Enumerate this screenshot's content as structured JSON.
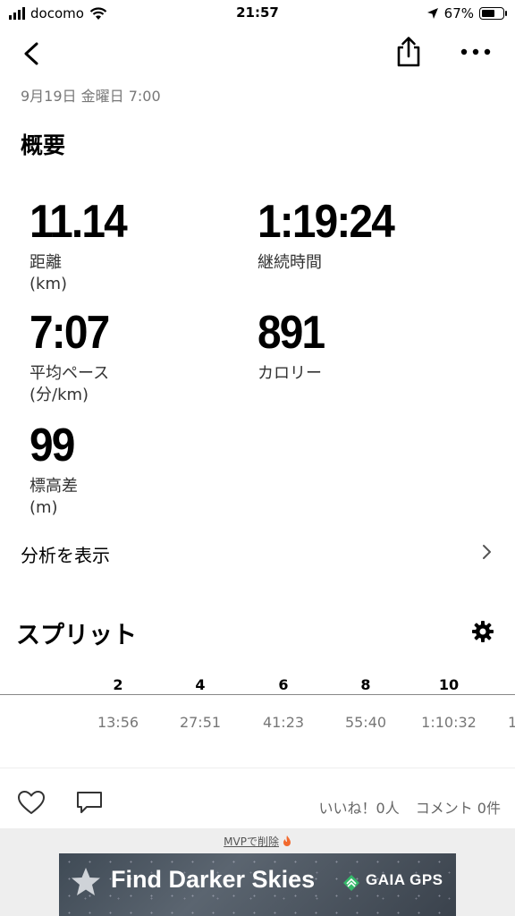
{
  "status_bar": {
    "carrier": "docomo",
    "time": "21:57",
    "battery": "67%"
  },
  "activity": {
    "date": "9月19日 金曜日 7:00",
    "summary_title": "概要",
    "metrics": [
      {
        "value": "11.14",
        "label": "距離",
        "unit": "(km)"
      },
      {
        "value": "1:19:24",
        "label": "継続時間",
        "unit": ""
      },
      {
        "value": "7:07",
        "label": "平均ペース",
        "unit": "(分/km)"
      },
      {
        "value": "891",
        "label": "カロリー",
        "unit": ""
      },
      {
        "value": "99",
        "label": "標高差",
        "unit": "(m)"
      }
    ],
    "analysis_link": "分析を表示"
  },
  "splits": {
    "title": "スプリット",
    "headers": [
      "2",
      "4",
      "6",
      "8",
      "10"
    ],
    "values": [
      "13:56",
      "27:51",
      "41:23",
      "55:40",
      "1:10:32",
      "1"
    ]
  },
  "social": {
    "likes": "いいね！0人",
    "comments": "コメント 0件"
  },
  "ad": {
    "remove_label": "MVPで削除",
    "headline": "Find Darker Skies",
    "brand": "GAIA GPS"
  },
  "icons": {
    "back": "chevron-left-icon",
    "share": "share-icon",
    "more": "more-icon",
    "chevron": "chevron-right-icon",
    "gear": "gear-icon",
    "heart": "heart-icon",
    "comment": "comment-icon"
  },
  "colors": {
    "accent_flame": "#f26a2e",
    "muted_text": "#777777"
  }
}
